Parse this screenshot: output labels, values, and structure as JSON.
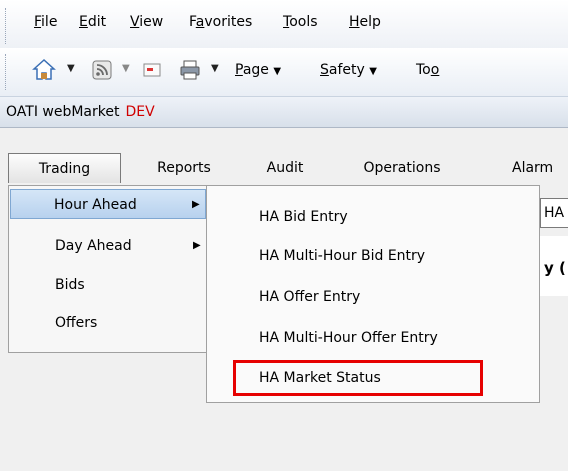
{
  "ie_menubar": {
    "items": [
      {
        "underline": "F",
        "rest": "ile"
      },
      {
        "underline": "E",
        "rest": "dit"
      },
      {
        "underline": "V",
        "rest": "iew"
      },
      {
        "pre": "F",
        "underline": "a",
        "rest": "vorites"
      },
      {
        "underline": "T",
        "rest": "ools"
      },
      {
        "underline": "H",
        "rest": "elp"
      }
    ]
  },
  "ie_cmdbar": {
    "icons": [
      "home-icon",
      "feeds-icon",
      "mail-icon",
      "print-icon"
    ],
    "page": {
      "underline": "P",
      "rest": "age"
    },
    "safety": {
      "underline": "S",
      "rest": "afety"
    },
    "tools_cut": {
      "pre": "To",
      "underline": "o"
    }
  },
  "title": {
    "app": "OATI webMarket",
    "env": "DEV"
  },
  "app_menu": [
    "Trading",
    "Reports",
    "Audit",
    "Operations",
    "Alarm"
  ],
  "dropdown": [
    "Hour Ahead",
    "Day Ahead",
    "Bids",
    "Offers"
  ],
  "submenu": [
    "HA Bid Entry",
    "HA Multi-Hour Bid Entry",
    "HA Offer Entry",
    "HA Multi-Hour Offer Entry",
    "HA Market Status"
  ],
  "right_stub": {
    "tab": "HA",
    "bold": "y ("
  },
  "colors": {
    "env": "#d00000",
    "highlight": "#e60000",
    "selected": "#b7d1ee"
  }
}
